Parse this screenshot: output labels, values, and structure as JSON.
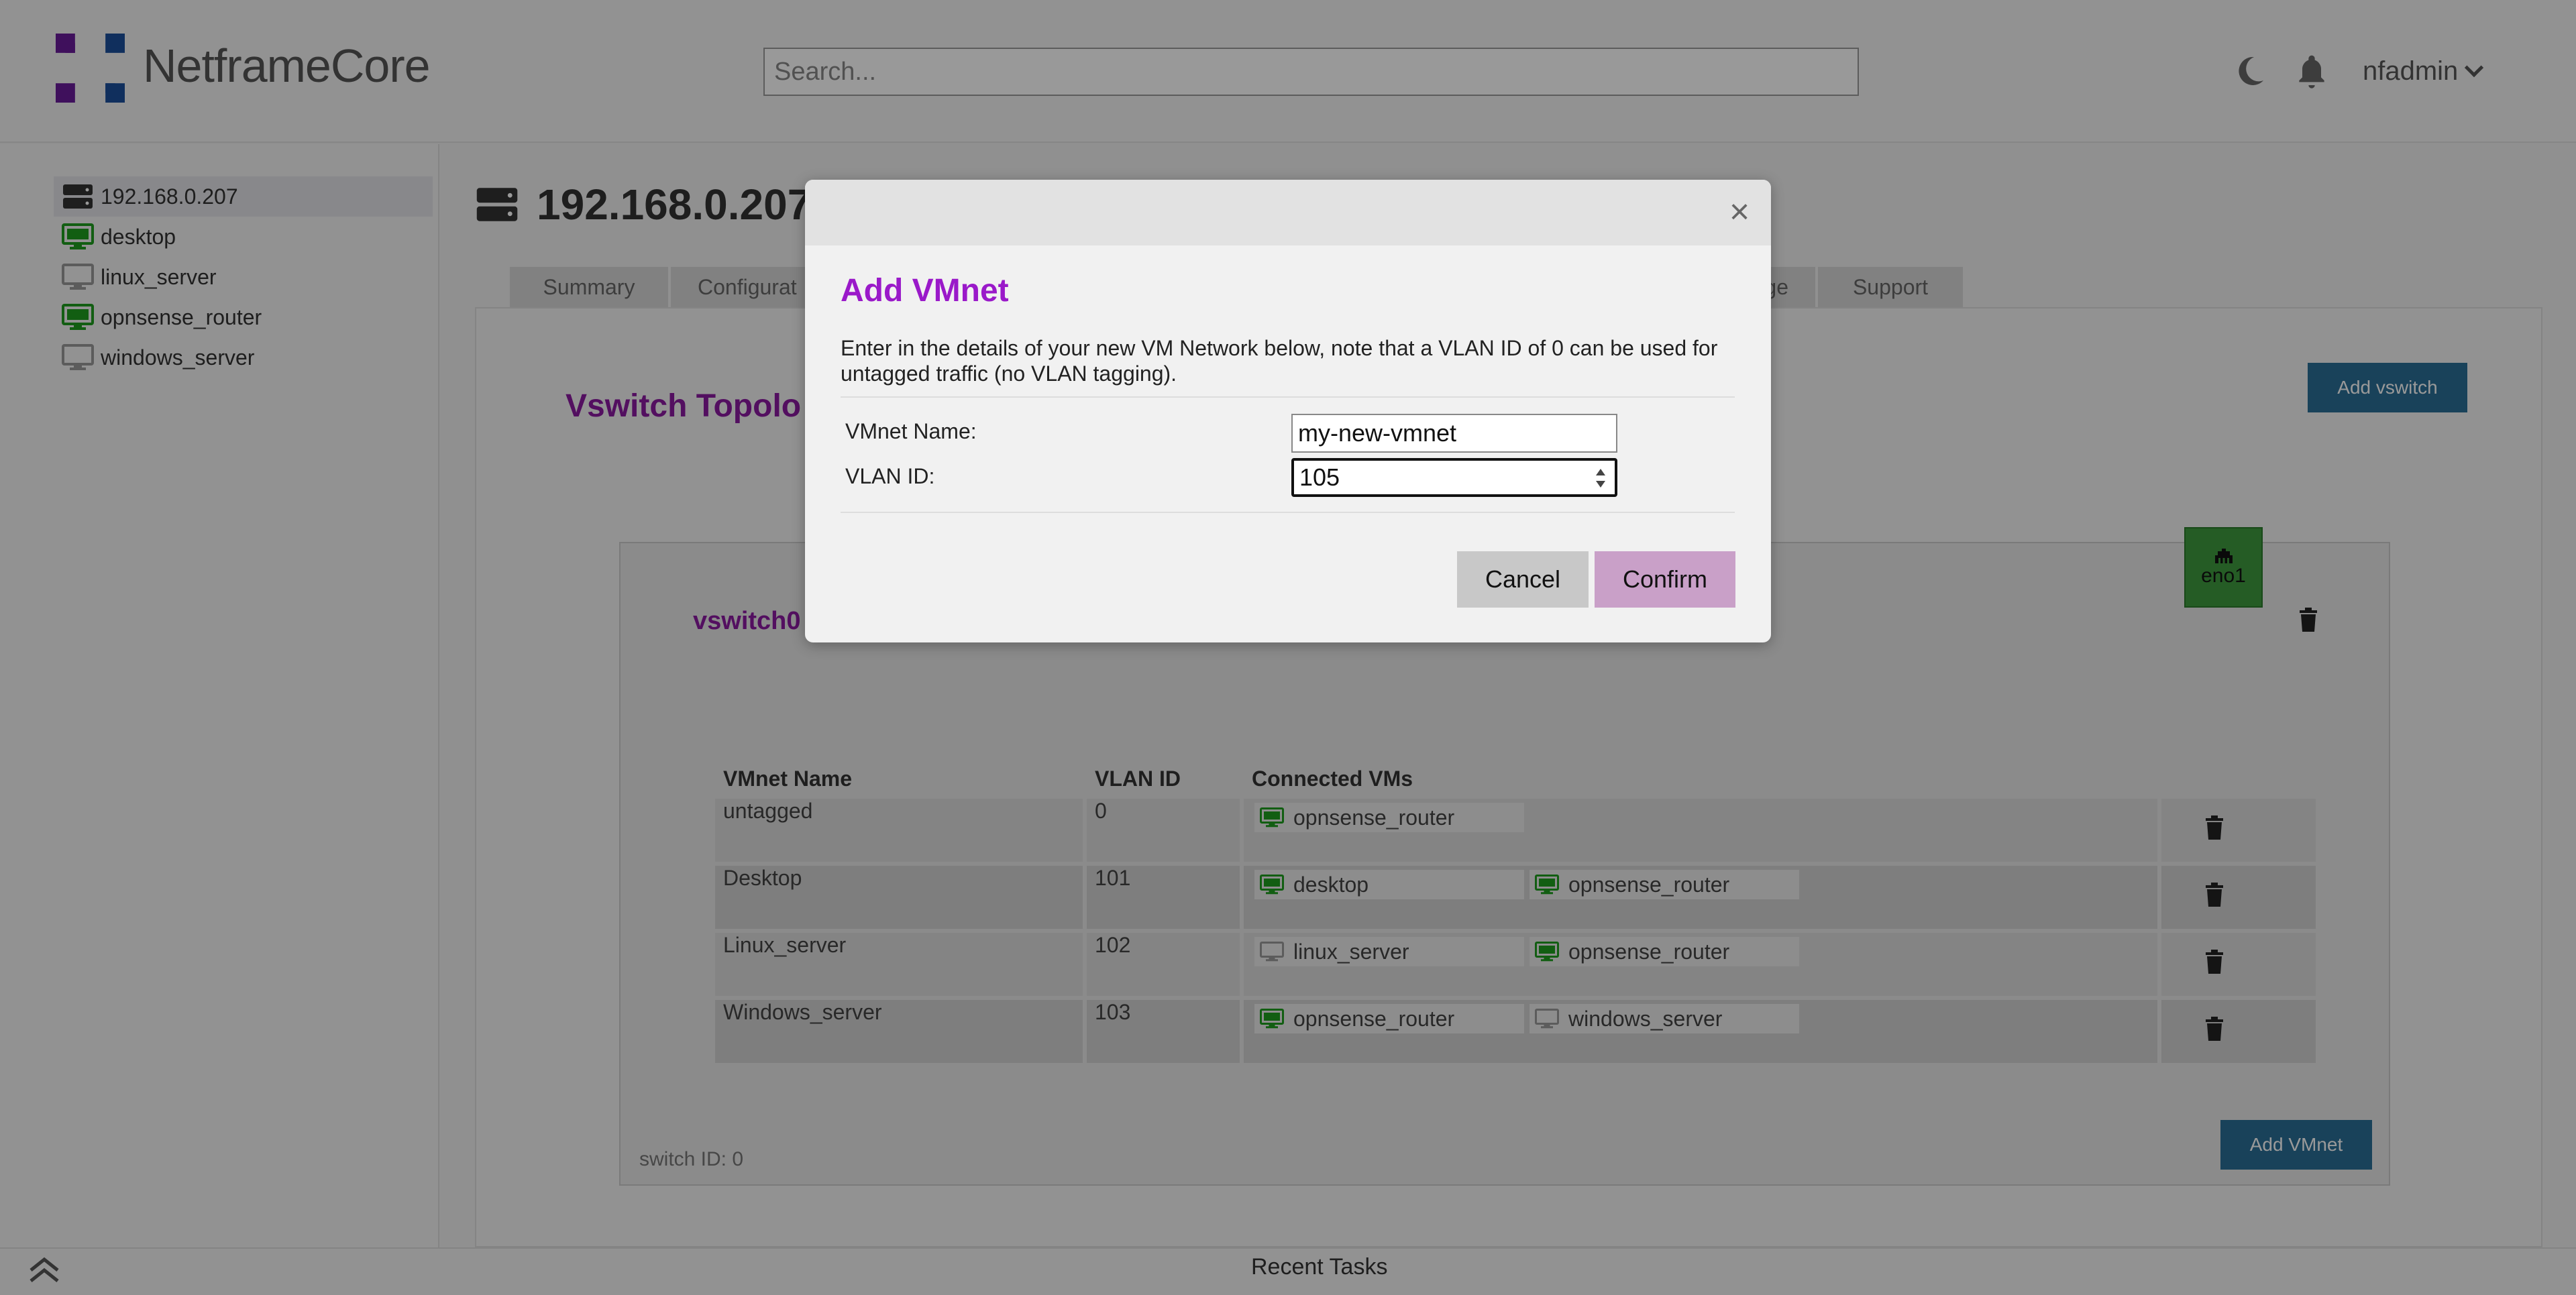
{
  "header": {
    "logo_text": "NetframeCore",
    "search_placeholder": "Search...",
    "user": "nfadmin"
  },
  "sidebar": {
    "items": [
      {
        "label": "192.168.0.207",
        "icon": "server-icon",
        "selected": true
      },
      {
        "label": "desktop",
        "icon": "monitor-icon",
        "status": "running"
      },
      {
        "label": "linux_server",
        "icon": "monitor-icon",
        "status": "stopped"
      },
      {
        "label": "opnsense_router",
        "icon": "monitor-icon",
        "status": "running"
      },
      {
        "label": "windows_server",
        "icon": "monitor-icon",
        "status": "stopped"
      }
    ]
  },
  "main": {
    "title": "192.168.0.207",
    "tabs": [
      "Summary",
      "Configurat",
      "rage",
      "Support"
    ],
    "section_title": "Vswitch Topolo",
    "add_vswitch_label": "Add vswitch",
    "vswitch": {
      "name": "vswitch0",
      "uplink": "eno1",
      "switch_id_label": "switch ID: 0",
      "add_vmnet_label": "Add VMnet",
      "columns": [
        "VMnet Name",
        "VLAN ID",
        "Connected VMs"
      ],
      "rows": [
        {
          "name": "untagged",
          "vlan": "0",
          "vms": [
            {
              "name": "opnsense_router",
              "status": "running"
            }
          ]
        },
        {
          "name": "Desktop",
          "vlan": "101",
          "vms": [
            {
              "name": "desktop",
              "status": "running"
            },
            {
              "name": "opnsense_router",
              "status": "running"
            }
          ]
        },
        {
          "name": "Linux_server",
          "vlan": "102",
          "vms": [
            {
              "name": "linux_server",
              "status": "stopped"
            },
            {
              "name": "opnsense_router",
              "status": "running"
            }
          ]
        },
        {
          "name": "Windows_server",
          "vlan": "103",
          "vms": [
            {
              "name": "opnsense_router",
              "status": "running"
            },
            {
              "name": "windows_server",
              "status": "stopped"
            }
          ]
        }
      ]
    }
  },
  "footer": {
    "recent_tasks": "Recent Tasks"
  },
  "modal": {
    "close": "×",
    "title": "Add VMnet",
    "description": "Enter in the details of your new VM Network below, note that a VLAN ID of 0 can be used for untagged traffic (no VLAN tagging).",
    "vmnet_name_label": "VMnet Name:",
    "vmnet_name_value": "my-new-vmnet",
    "vlan_id_label": "VLAN ID:",
    "vlan_id_value": "105",
    "cancel_label": "Cancel",
    "confirm_label": "Confirm"
  },
  "colors": {
    "accent_purple": "#9a19c9",
    "running_green": "#1f9d1f",
    "stopped_gray": "#999999",
    "button_blue": "#2a6f97"
  }
}
